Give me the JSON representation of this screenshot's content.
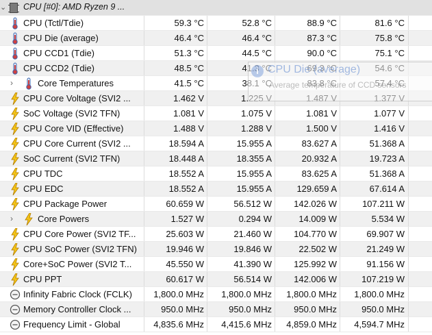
{
  "header": {
    "title": "CPU [#0]: AMD Ryzen 9 ..."
  },
  "rows": [
    {
      "name": "CPU (Tctl/Tdie)",
      "icon": "thermometer-icon",
      "v": [
        "59.3 °C",
        "52.8 °C",
        "88.9 °C",
        "81.6 °C"
      ]
    },
    {
      "name": "CPU Die (average)",
      "icon": "thermometer-icon",
      "v": [
        "46.4 °C",
        "46.4 °C",
        "87.3 °C",
        "75.8 °C"
      ]
    },
    {
      "name": "CPU CCD1 (Tdie)",
      "icon": "thermometer-icon",
      "v": [
        "51.3 °C",
        "44.5 °C",
        "90.0 °C",
        "75.1 °C"
      ]
    },
    {
      "name": "CPU CCD2 (Tdie)",
      "icon": "thermometer-icon",
      "v": [
        "48.5 °C",
        "41.3 °C",
        "69.3 °C",
        "54.6 °C"
      ]
    },
    {
      "name": "Core Temperatures",
      "icon": "thermometer-icon",
      "group": true,
      "v": [
        "41.5 °C",
        "38.1 °C",
        "83.8 °C",
        "57.4 °C"
      ]
    },
    {
      "name": "CPU Core Voltage (SVI2 ...",
      "icon": "lightning-icon",
      "v": [
        "1.462 V",
        "1.225 V",
        "1.487 V",
        "1.377 V"
      ]
    },
    {
      "name": "SoC Voltage (SVI2 TFN)",
      "icon": "lightning-icon",
      "v": [
        "1.081 V",
        "1.075 V",
        "1.081 V",
        "1.077 V"
      ]
    },
    {
      "name": "CPU Core VID (Effective)",
      "icon": "lightning-icon",
      "v": [
        "1.488 V",
        "1.288 V",
        "1.500 V",
        "1.416 V"
      ]
    },
    {
      "name": "CPU Core Current (SVI2 ...",
      "icon": "lightning-icon",
      "v": [
        "18.594 A",
        "15.955 A",
        "83.627 A",
        "51.368 A"
      ]
    },
    {
      "name": "SoC Current (SVI2 TFN)",
      "icon": "lightning-icon",
      "v": [
        "18.448 A",
        "18.355 A",
        "20.932 A",
        "19.723 A"
      ]
    },
    {
      "name": "CPU TDC",
      "icon": "lightning-icon",
      "v": [
        "18.552 A",
        "15.955 A",
        "83.625 A",
        "51.368 A"
      ]
    },
    {
      "name": "CPU EDC",
      "icon": "lightning-icon",
      "v": [
        "18.552 A",
        "15.955 A",
        "129.659 A",
        "67.614 A"
      ]
    },
    {
      "name": "CPU Package Power",
      "icon": "lightning-icon",
      "v": [
        "60.659 W",
        "56.512 W",
        "142.026 W",
        "107.211 W"
      ]
    },
    {
      "name": "Core Powers",
      "icon": "lightning-icon",
      "group": true,
      "v": [
        "1.527 W",
        "0.294 W",
        "14.009 W",
        "5.534 W"
      ]
    },
    {
      "name": "CPU Core Power (SVI2 TF...",
      "icon": "lightning-icon",
      "v": [
        "25.603 W",
        "21.460 W",
        "104.770 W",
        "69.907 W"
      ]
    },
    {
      "name": "CPU SoC Power (SVI2 TFN)",
      "icon": "lightning-icon",
      "v": [
        "19.946 W",
        "19.846 W",
        "22.502 W",
        "21.249 W"
      ]
    },
    {
      "name": "Core+SoC Power (SVI2 T...",
      "icon": "lightning-icon",
      "v": [
        "45.550 W",
        "41.390 W",
        "125.992 W",
        "91.156 W"
      ]
    },
    {
      "name": "CPU PPT",
      "icon": "lightning-icon",
      "v": [
        "60.617 W",
        "56.514 W",
        "142.006 W",
        "107.219 W"
      ]
    },
    {
      "name": "Infinity Fabric Clock (FCLK)",
      "icon": "clock-icon",
      "v": [
        "1,800.0 MHz",
        "1,800.0 MHz",
        "1,800.0 MHz",
        "1,800.0 MHz"
      ]
    },
    {
      "name": "Memory Controller Clock ...",
      "icon": "clock-icon",
      "v": [
        "950.0 MHz",
        "950.0 MHz",
        "950.0 MHz",
        "950.0 MHz"
      ]
    },
    {
      "name": "Frequency Limit - Global",
      "icon": "clock-icon",
      "v": [
        "4,835.6 MHz",
        "4,415.6 MHz",
        "4,859.0 MHz",
        "4,594.7 MHz"
      ]
    }
  ],
  "tooltip": {
    "title": "CPU Die (average)",
    "description": "Average temperature of CCD sensors"
  }
}
